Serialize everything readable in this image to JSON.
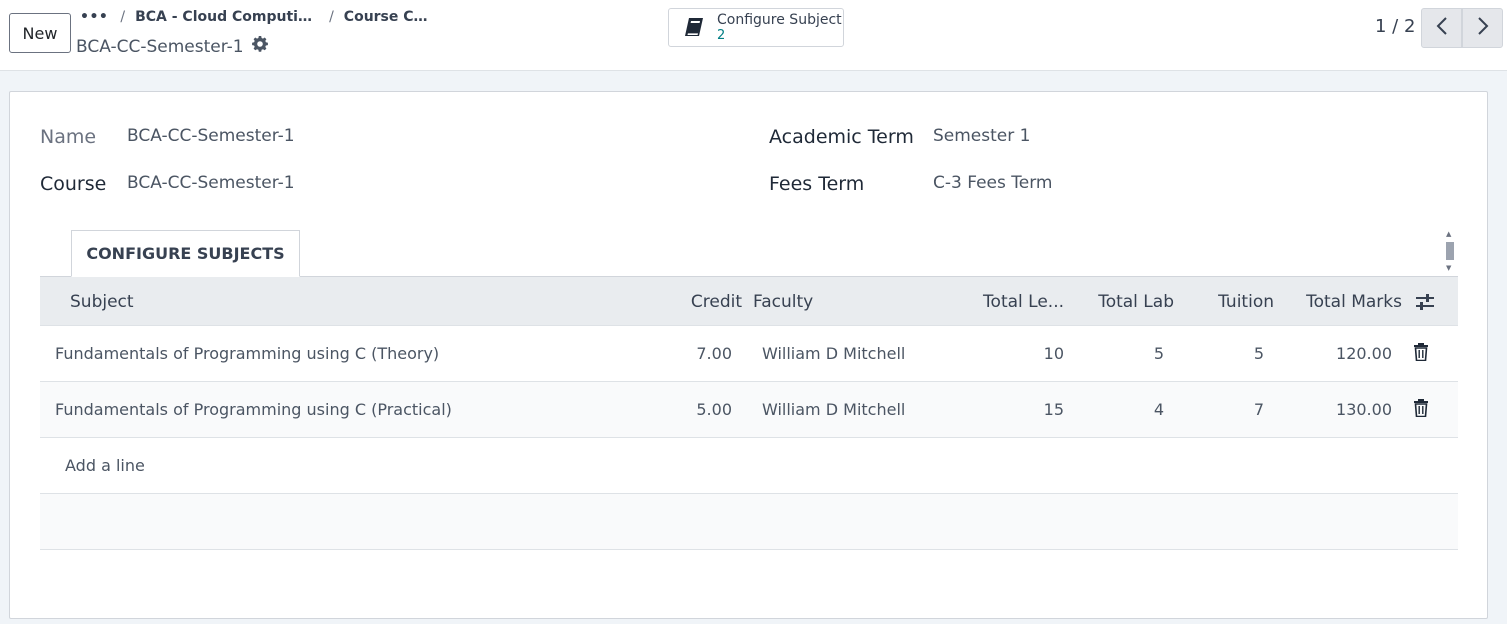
{
  "control_panel": {
    "new_label": "New",
    "breadcrumb": {
      "dots": "•••",
      "items": [
        "BCA - Cloud Computing...",
        "Course Co..."
      ],
      "separator": "/"
    },
    "record_title": "BCA-CC-Semester-1",
    "smart_button": {
      "label": "Configure Subject",
      "count": "2",
      "icon": "book-icon"
    },
    "pager": {
      "value": "1 / 2"
    }
  },
  "form": {
    "fields": {
      "name_label": "Name",
      "name_value": "BCA-CC-Semester-1",
      "course_label": "Course",
      "course_value": "BCA-CC-Semester-1",
      "academic_term_label": "Academic Term",
      "academic_term_value": "Semester 1",
      "fees_term_label": "Fees Term",
      "fees_term_value": "C-3 Fees Term"
    },
    "tab_label": "CONFIGURE SUBJECTS",
    "table": {
      "columns": [
        "Subject",
        "Credit",
        "Faculty",
        "Total Le...",
        "Total Lab",
        "Tuition",
        "Total Marks"
      ],
      "rows": [
        {
          "subject": "Fundamentals of Programming using C (Theory)",
          "credit": "7.00",
          "faculty": "William D Mitchell",
          "total_lecture": "10",
          "total_lab": "5",
          "tuition": "5",
          "total_marks": "120.00"
        },
        {
          "subject": "Fundamentals of Programming using C (Practical)",
          "credit": "5.00",
          "faculty": "William D Mitchell",
          "total_lecture": "15",
          "total_lab": "4",
          "tuition": "7",
          "total_marks": "130.00"
        }
      ],
      "add_line_label": "Add a line"
    }
  },
  "colors": {
    "accent_link": "#017e84",
    "header_bg": "#e9ecef",
    "background": "#f0f4f8"
  }
}
